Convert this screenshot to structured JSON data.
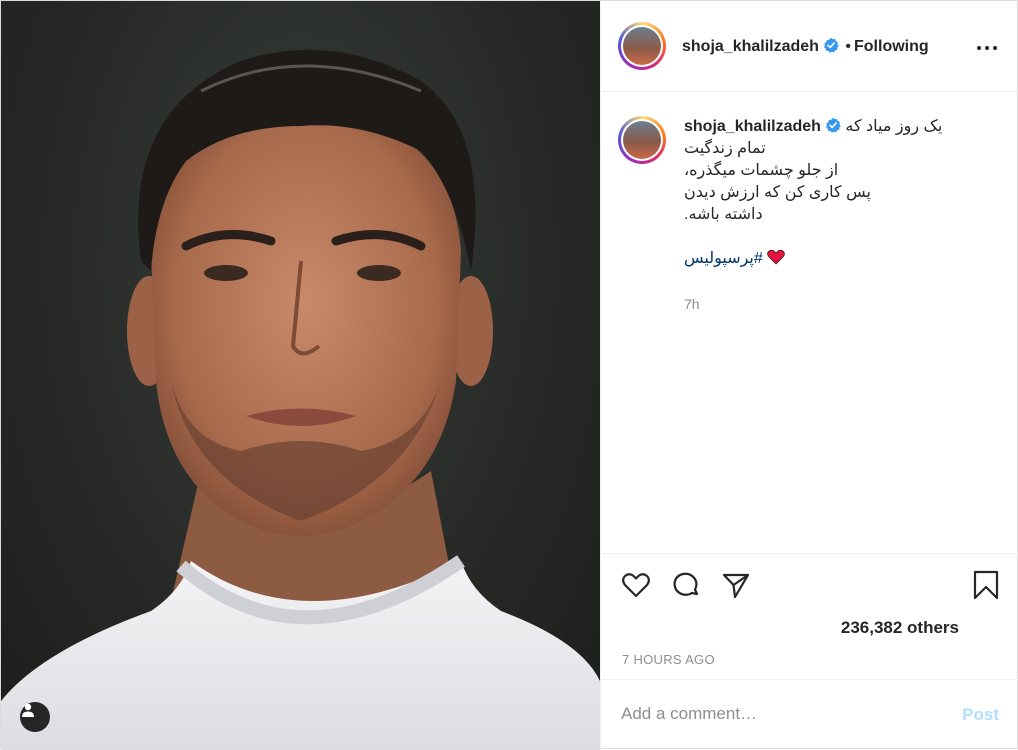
{
  "post": {
    "username": "shoja_khalilzadeh",
    "follow_separator": "•",
    "follow_status": "Following",
    "caption": {
      "username": "shoja_khalilzadeh",
      "line1": "یک روز میاد که",
      "line2": "تمام زندگیت",
      "line3": "از جلو چشمات میگذره،",
      "line4": "پس کاری کن که ارزش دیدن",
      "line5": "داشته باشه.",
      "hashtag": "#پرسپولیس",
      "timestamp": "7h"
    },
    "likes_text": "236,382 others",
    "posted_ago": "7 HOURS AGO",
    "comment": {
      "placeholder": "Add a comment…",
      "value": "",
      "post_label": "Post"
    }
  },
  "colors": {
    "verified_blue": "#3897f0",
    "heart_red": "#e8123c",
    "post_button_disabled": "#b2dffc",
    "hashtag": "#00376b",
    "muted_text": "#8e8e8e"
  },
  "icons": [
    "heart-icon",
    "comment-icon",
    "share-icon",
    "bookmark-icon",
    "more-options-icon",
    "verified-badge-icon",
    "user-tag-icon"
  ]
}
